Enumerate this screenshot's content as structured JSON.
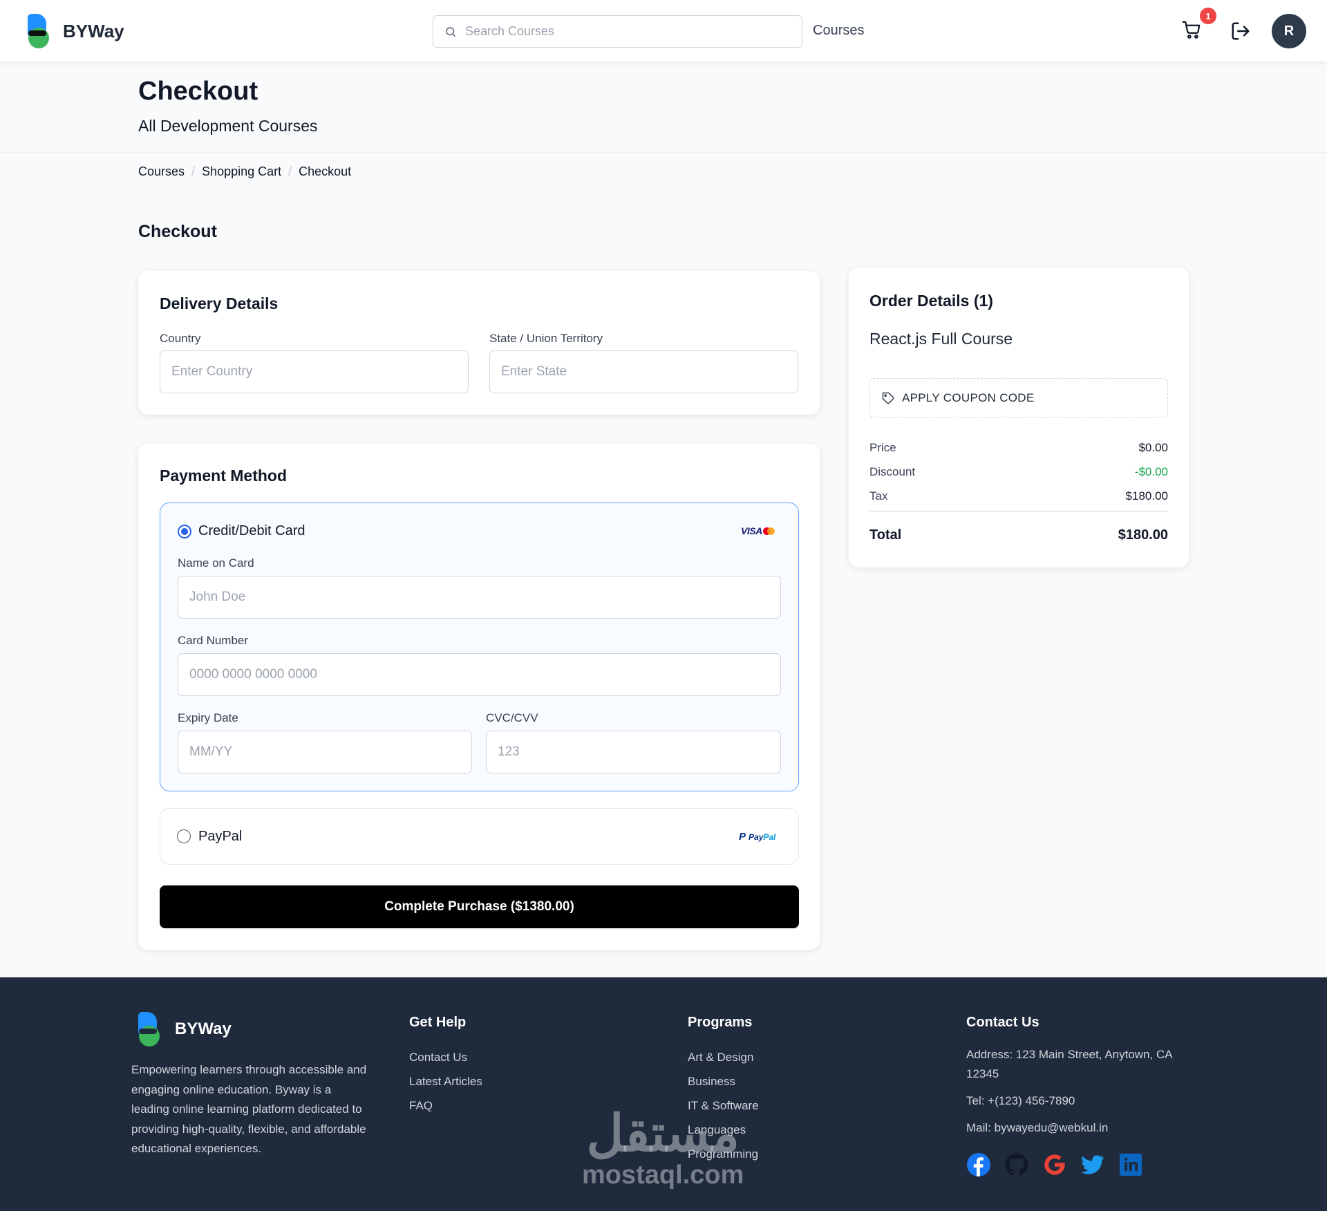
{
  "header": {
    "brand": "BYWay",
    "search_placeholder": "Search Courses",
    "nav_courses": "Courses",
    "cart_count": "1",
    "avatar_initial": "R"
  },
  "hero": {
    "title": "Checkout",
    "subtitle": "All Development Courses"
  },
  "breadcrumb": [
    "Courses",
    "Shopping Cart",
    "Checkout"
  ],
  "section_title": "Checkout",
  "delivery": {
    "title": "Delivery Details",
    "country_label": "Country",
    "country_placeholder": "Enter Country",
    "state_label": "State / Union Territory",
    "state_placeholder": "Enter State"
  },
  "payment": {
    "title": "Payment Method",
    "card_option": "Credit/Debit Card",
    "card_selected": true,
    "card_brand_text": "VISA",
    "name_label": "Name on Card",
    "name_placeholder": "John Doe",
    "number_label": "Card Number",
    "number_placeholder": "0000 0000 0000 0000",
    "expiry_label": "Expiry Date",
    "expiry_placeholder": "MM/YY",
    "cvc_label": "CVC/CVV",
    "cvc_placeholder": "123",
    "paypal_option": "PayPal",
    "paypal_logo_pay": "Pay",
    "paypal_logo_pal": "Pal",
    "purchase_button": "Complete Purchase ($1380.00)"
  },
  "order": {
    "title": "Order Details (1)",
    "course": "React.js Full Course",
    "coupon_label": "APPLY COUPON CODE",
    "price_label": "Price",
    "price_value": "$0.00",
    "discount_label": "Discount",
    "discount_value": "-$0.00",
    "tax_label": "Tax",
    "tax_value": "$180.00",
    "total_label": "Total",
    "total_value": "$180.00"
  },
  "footer": {
    "brand": "BYWay",
    "about": "Empowering learners through accessible and engaging online education. Byway is a leading online learning platform dedicated to providing high-quality, flexible, and affordable educational experiences.",
    "help_title": "Get Help",
    "help_links": [
      "Contact Us",
      "Latest Articles",
      "FAQ"
    ],
    "programs_title": "Programs",
    "programs_links": [
      "Art & Design",
      "Business",
      "IT & Software",
      "Languages",
      "Programming"
    ],
    "contact_title": "Contact Us",
    "address": "Address: 123 Main Street, Anytown, CA 12345",
    "tel": "Tel: +(123) 456-7890",
    "mail": "Mail: bywayedu@webkul.in",
    "socials": [
      "facebook-icon",
      "github-icon",
      "google-icon",
      "twitter-icon",
      "linkedin-icon"
    ]
  },
  "watermark": {
    "arabic": "مستقل",
    "latin": "mostaql.com"
  },
  "colors": {
    "accent_blue": "#2563eb",
    "footer_bg": "#1f2a3c",
    "discount_green": "#16a34a",
    "badge_red": "#ef4444"
  }
}
